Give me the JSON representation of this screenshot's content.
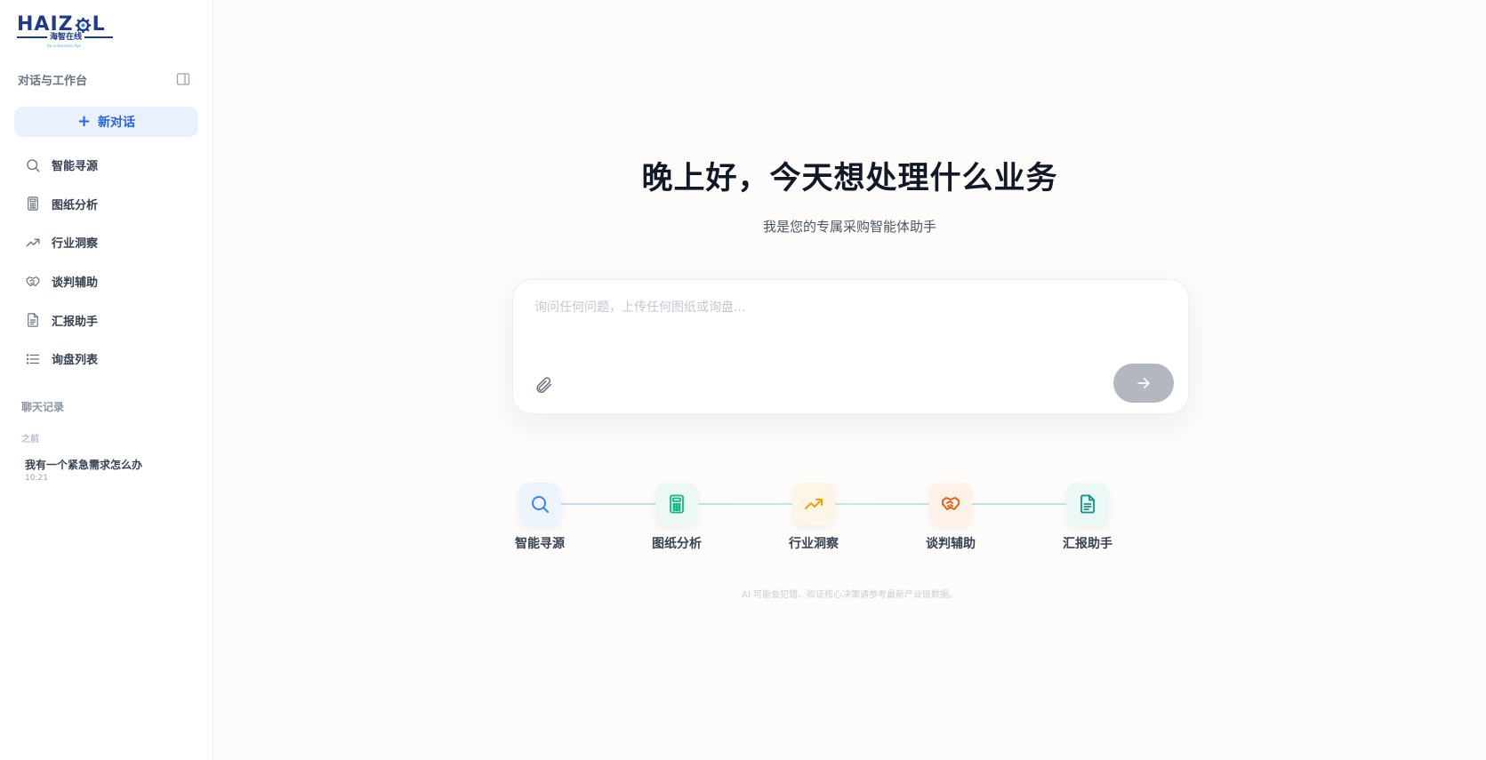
{
  "logo": {
    "main_left": "HAIZ",
    "main_right": "L",
    "sub": "海智在线",
    "tiny": "Be in Business Age"
  },
  "sidebar": {
    "section_title": "对话与工作台",
    "new_chat_label": "新对话",
    "items": [
      {
        "label": "智能寻源",
        "icon": "search-icon"
      },
      {
        "label": "图纸分析",
        "icon": "calculator-icon"
      },
      {
        "label": "行业洞察",
        "icon": "trending-up-icon"
      },
      {
        "label": "谈判辅助",
        "icon": "handshake-icon"
      },
      {
        "label": "汇报助手",
        "icon": "file-text-icon"
      },
      {
        "label": "询盘列表",
        "icon": "list-icon"
      }
    ],
    "history_title": "聊天记录",
    "history_group": "之前",
    "history": [
      {
        "title": "我有一个紧急需求怎么办",
        "time": "10:21"
      }
    ]
  },
  "main": {
    "greeting": "晚上好，今天想处理什么业务",
    "subtitle": "我是您的专属采购智能体助手",
    "input_placeholder": "询问任何问题，上传任何图纸或询盘...",
    "steps": [
      {
        "label": "智能寻源",
        "icon": "search-icon",
        "color": "#3b82f6",
        "bg": "#eef4fd"
      },
      {
        "label": "图纸分析",
        "icon": "calculator-icon",
        "color": "#10b981",
        "bg": "#ebf8f3"
      },
      {
        "label": "行业洞察",
        "icon": "trending-up-icon",
        "color": "#f59e0b",
        "bg": "#fdf6e6"
      },
      {
        "label": "谈判辅助",
        "icon": "handshake-icon",
        "color": "#ea580c",
        "bg": "#fdf1e8"
      },
      {
        "label": "汇报助手",
        "icon": "file-text-icon",
        "color": "#0d9488",
        "bg": "#ebf8f5"
      }
    ],
    "disclaimer": "AI 可能会犯错。验证核心决策请参考最新产业链数据。"
  },
  "colors": {
    "accent": "#2563eb",
    "send_disabled": "#b3b8bf",
    "brand": "#1e3a8a"
  }
}
